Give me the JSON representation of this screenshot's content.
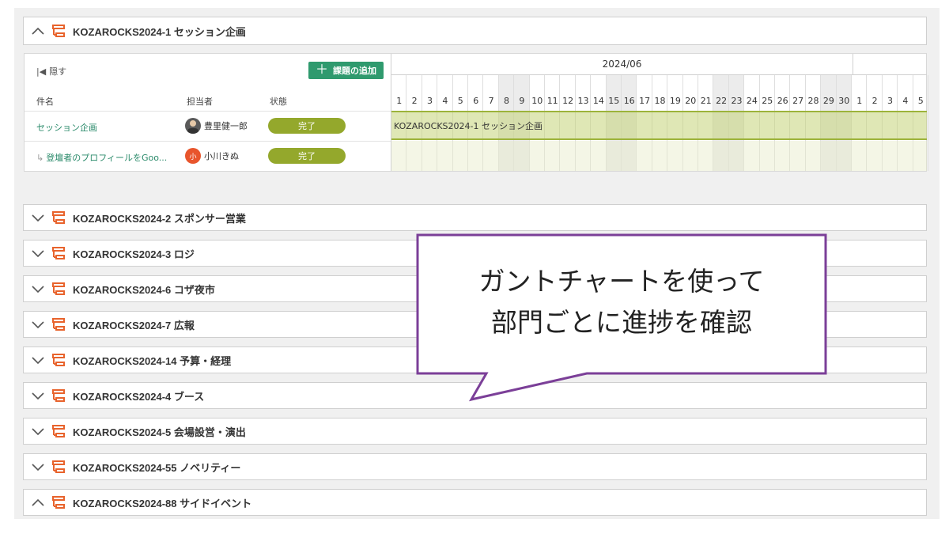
{
  "groups": [
    {
      "label": "KOZAROCKS2024-1 セッション企画",
      "state": "expanded"
    },
    {
      "label": "KOZAROCKS2024-2 スポンサー営業",
      "state": "collapsed"
    },
    {
      "label": "KOZAROCKS2024-3 ロジ",
      "state": "collapsed"
    },
    {
      "label": "KOZAROCKS2024-6 コザ夜市",
      "state": "collapsed"
    },
    {
      "label": "KOZAROCKS2024-7 広報",
      "state": "collapsed"
    },
    {
      "label": "KOZAROCKS2024-14 予算・経理",
      "state": "collapsed"
    },
    {
      "label": "KOZAROCKS2024-4 ブース",
      "state": "collapsed"
    },
    {
      "label": "KOZAROCKS2024-5 会場設営・演出",
      "state": "collapsed"
    },
    {
      "label": "KOZAROCKS2024-55 ノベリティー",
      "state": "collapsed"
    },
    {
      "label": "KOZAROCKS2024-88 サイドイベント",
      "state": "expanded"
    }
  ],
  "gantt": {
    "hide_label": "隠す",
    "add_button": "課題の追加",
    "columns": {
      "task": "件名",
      "assignee": "担当者",
      "status": "状態"
    },
    "month": "2024/06",
    "days": [
      "1",
      "2",
      "3",
      "4",
      "5",
      "6",
      "7",
      "8",
      "9",
      "10",
      "11",
      "12",
      "13",
      "14",
      "15",
      "16",
      "17",
      "18",
      "19",
      "20",
      "21",
      "22",
      "23",
      "24",
      "25",
      "26",
      "27",
      "28",
      "29",
      "30",
      "1",
      "2",
      "3",
      "4",
      "5"
    ],
    "rows": [
      {
        "task": "セッション企画",
        "assignee": "豊里健一郎",
        "status": "完了"
      },
      {
        "task": "登壇者のプロフィールをGoo...",
        "assignee": "小川きぬ",
        "avatar_text": "小",
        "status": "完了"
      }
    ],
    "bar_label": "KOZAROCKS2024-1  セッション企画"
  },
  "callout": {
    "line1": "ガントチャートを使って",
    "line2": "部門ごとに進捗を確認"
  },
  "colors": {
    "project_icon": "#e8632c",
    "add_button": "#2f9a6e",
    "status_done": "#94a82c",
    "callout_border": "#7b3f98",
    "task_link": "#2a8a6a"
  }
}
